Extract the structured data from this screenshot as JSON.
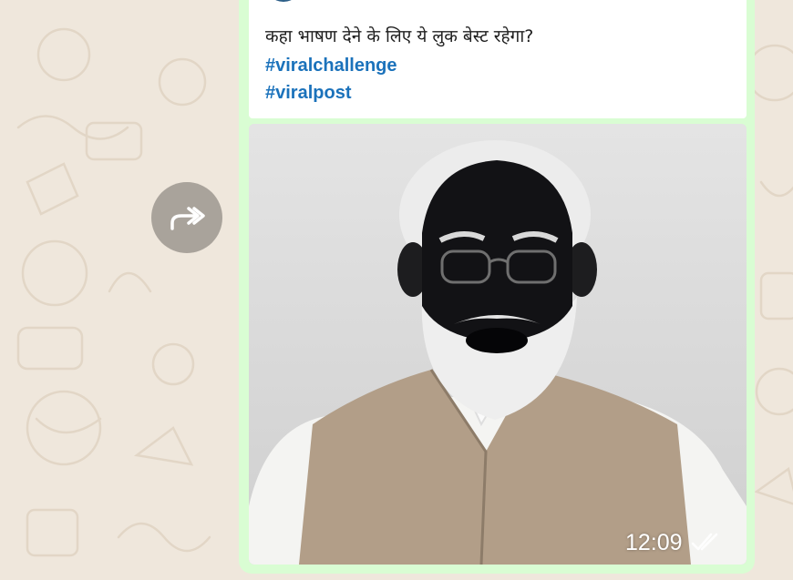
{
  "chat": {
    "background_color": "#efe7dc",
    "forward_button": {
      "icon": "forward-arrow-icon"
    }
  },
  "message": {
    "bubble_color": "#d9fdd3",
    "quoted_post": {
      "avatar": "channel-logo",
      "text": "कहा भाषण देने के लिए ये लुक बेस्ट रहेगा?",
      "hashtags": [
        "#viralchallenge",
        "#viralpost"
      ],
      "hashtag_color": "#1b72bb"
    },
    "image": "photo of bearded man with painted black face, glasses, white kurta and beige vest",
    "time": "12:09",
    "status_icon": "double-check-icon"
  }
}
